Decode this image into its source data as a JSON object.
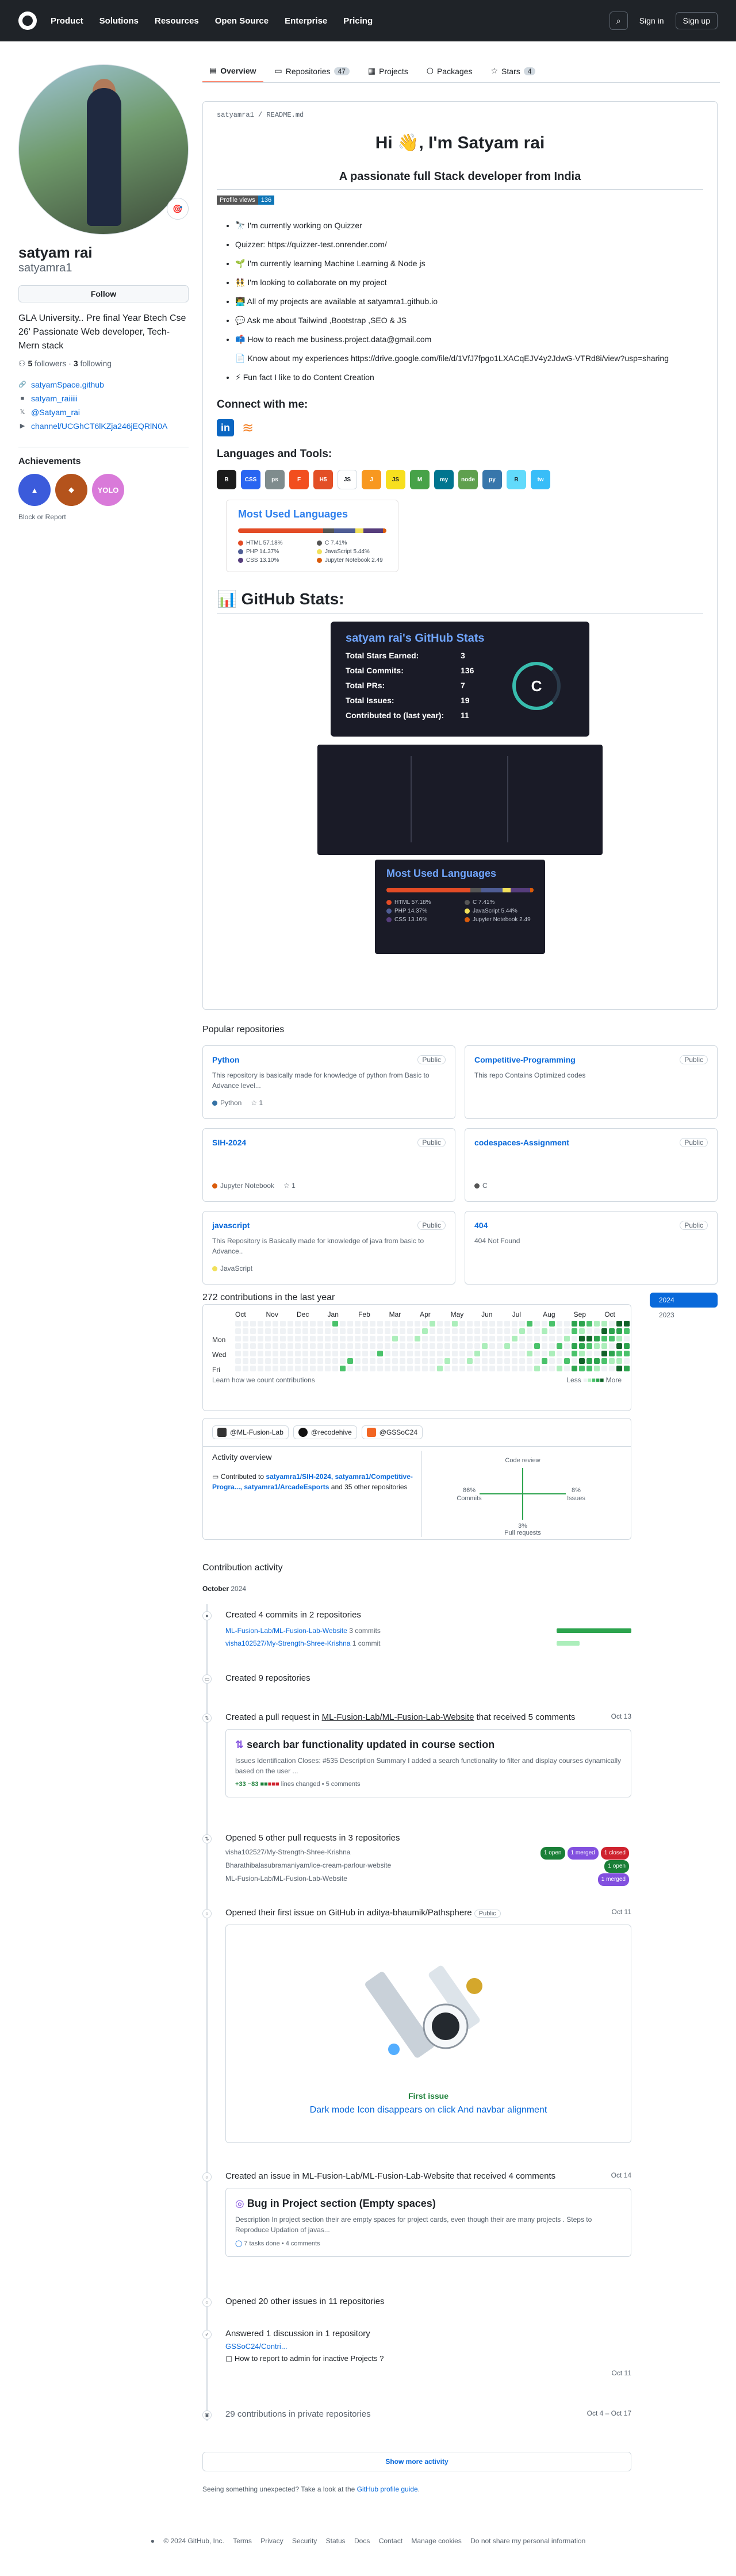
{
  "header": {
    "nav": [
      "Product",
      "Solutions",
      "Resources",
      "Open Source",
      "Enterprise",
      "Pricing"
    ],
    "sign_in": "Sign in",
    "sign_up": "Sign up"
  },
  "tabs": [
    {
      "label": "Overview",
      "count": ""
    },
    {
      "label": "Repositories",
      "count": "47"
    },
    {
      "label": "Projects",
      "count": ""
    },
    {
      "label": "Packages",
      "count": ""
    },
    {
      "label": "Stars",
      "count": "4"
    }
  ],
  "profile": {
    "name": "satyam rai",
    "login": "satyamra1",
    "follow": "Follow",
    "bio": "GLA University.. Pre final Year Btech Cse 26' Passionate Web developer, Tech-Mern stack",
    "followers": "5",
    "followers_label": "followers",
    "following": "3",
    "following_label": "following",
    "links": [
      "satyamSpace.github",
      "satyam_raiiiii",
      "@Satyam_rai",
      "channel/UCGhCT6lKZja246jEQRlN0A"
    ],
    "achievements_title": "Achievements",
    "block": "Block or Report"
  },
  "readme": {
    "path": "satyamra1 / README.md",
    "title": "Hi 👋, I'm Satyam rai",
    "subtitle": "A passionate full Stack developer from India",
    "profile_views_label": "Profile views",
    "profile_views": "136",
    "bullets": [
      "🔭 I'm currently working on Quizzer",
      "Quizzer: https://quizzer-test.onrender.com/",
      "🌱 I'm currently learning Machine Learning & Node js",
      "👯 I'm looking to collaborate on my project",
      "👨‍💻 All of my projects are available at satyamra1.github.io",
      "💬 Ask me about Tailwind ,Bootstrap ,SEO & JS",
      "📫 How to reach me business.project.data@gmail.com",
      "📄 Know about my experiences https://drive.google.com/file/d/1VfJ7fpgo1LXACqEJV4y2JdwG-VTRd8i/view?usp=sharing",
      "⚡ Fun fact I like to do Content Creation"
    ],
    "connect": "Connect with me:",
    "tools_title": "Languages and Tools:",
    "tools": [
      "B",
      "CSS",
      "ps",
      "F",
      "H5",
      "JS",
      "J",
      "JS",
      "M",
      "my",
      "node",
      "py",
      "R",
      "tw"
    ],
    "tool_colors": [
      "#1b1b1b",
      "#2965f1",
      "#7f8c8d",
      "#f24e1e",
      "#e34f26",
      "#ffffff",
      "#f89820",
      "#f7df1e",
      "#47a248",
      "#00758f",
      "#5fa04e",
      "#3776ab",
      "#61dafb",
      "#38bdf8"
    ],
    "most_used": "Most Used Languages",
    "languages": [
      {
        "name": "HTML",
        "pct": "57.18%",
        "color": "#e34c26",
        "v": 57.18
      },
      {
        "name": "C",
        "pct": "7.41%",
        "color": "#555555",
        "v": 7.41
      },
      {
        "name": "PHP",
        "pct": "14.37%",
        "color": "#4f5d95",
        "v": 14.37
      },
      {
        "name": "JavaScript",
        "pct": "5.44%",
        "color": "#f1e05a",
        "v": 5.44
      },
      {
        "name": "CSS",
        "pct": "13.10%",
        "color": "#563d7c",
        "v": 13.1
      },
      {
        "name": "Jupyter Notebook",
        "pct": "2.49",
        "color": "#da5b0b",
        "v": 2.49
      }
    ],
    "stats_heading": "📊 GitHub Stats:",
    "stats_title": "satyam rai's GitHub Stats",
    "stats": [
      {
        "label": "Total Stars Earned:",
        "value": "3"
      },
      {
        "label": "Total Commits:",
        "value": "136"
      },
      {
        "label": "Total PRs:",
        "value": "7"
      },
      {
        "label": "Total Issues:",
        "value": "19"
      },
      {
        "label": "Contributed to (last year):",
        "value": "11"
      }
    ],
    "grade": "C"
  },
  "popular": {
    "title": "Popular repositories",
    "repos": [
      {
        "name": "Python",
        "vis": "Public",
        "desc": "This repository is basically made for knowledge of python from Basic to Advance level...",
        "lang": "Python",
        "color": "#3572a5",
        "stars": "1"
      },
      {
        "name": "Competitive-Programming",
        "vis": "Public",
        "desc": "This repo Contains Optimized codes",
        "lang": "",
        "color": "",
        "stars": ""
      },
      {
        "name": "SIH-2024",
        "vis": "Public",
        "desc": "",
        "lang": "Jupyter Notebook",
        "color": "#da5b0b",
        "stars": "1"
      },
      {
        "name": "codespaces-Assignment",
        "vis": "Public",
        "desc": "",
        "lang": "C",
        "color": "#555555",
        "stars": ""
      },
      {
        "name": "javascript",
        "vis": "Public",
        "desc": "This Repository is Basically made for knowledge of java from basic to Advance..",
        "lang": "JavaScript",
        "color": "#f1e05a",
        "stars": ""
      },
      {
        "name": "404",
        "vis": "Public",
        "desc": "404 Not Found",
        "lang": "",
        "color": "",
        "stars": ""
      }
    ]
  },
  "contributions": {
    "title": "272 contributions in the last year",
    "months": [
      "Oct",
      "Nov",
      "Dec",
      "Jan",
      "Feb",
      "Mar",
      "Apr",
      "May",
      "Jun",
      "Jul",
      "Aug",
      "Sep",
      "Oct"
    ],
    "days": [
      "Mon",
      "Wed",
      "Fri"
    ],
    "learn": "Learn how we count contributions",
    "less": "Less",
    "more": "More",
    "years": [
      "2024",
      "2023"
    ]
  },
  "overview": {
    "orgs": [
      "@ML-Fusion-Lab",
      "@recodehive",
      "@GSSoC24"
    ],
    "org_colors": [
      "#333333",
      "#111111",
      "#f26522"
    ],
    "title": "Activity overview",
    "contributed_prefix": "Contributed to",
    "contributed_repos": "satyamra1/SIH-2024, satyamra1/Competitive-Progra..., satyamra1/ArcadeEsports",
    "contributed_more": "and 35 other repositories",
    "axes": {
      "top": "Code review",
      "left_pct": "86%",
      "left": "Commits",
      "right_pct": "8%",
      "right": "Issues",
      "bottom_pct": "3%",
      "bottom": "Pull requests"
    }
  },
  "activity": {
    "title": "Contribution activity",
    "month": "October",
    "year": "2024",
    "commits_title": "Created 4 commits in 2 repositories",
    "commit_repos": [
      {
        "name": "ML-Fusion-Lab/ML-Fusion-Lab-Website",
        "count": "3 commits",
        "v": 0.9
      },
      {
        "name": "visha102527/My-Strength-Shree-Krishna",
        "count": "1 commit",
        "v": 0.3
      }
    ],
    "repos_title": "Created 9 repositories",
    "pr_title_prefix": "Created a pull request in",
    "pr_repo": "ML-Fusion-Lab/ML-Fusion-Lab-Website",
    "pr_title_suffix": "that received 5 comments",
    "pr_date": "Oct 13",
    "pr_name": "search bar functionality updated in course section",
    "pr_desc": "Issues Identification Closes: #535 Description Summary I added a search functionality to filter and display courses dynamically based on the user ...",
    "pr_stats": "+33 −83",
    "pr_lines": "lines changed",
    "pr_comments": "• 5 comments",
    "open_prs_title": "Opened 5 other pull requests in 3 repositories",
    "open_prs": [
      {
        "name": "visha102527/My-Strength-Shree-Krishna",
        "badges": [
          "1 open",
          "1 merged",
          "1 closed"
        ]
      },
      {
        "name": "Bharathibalasubramaniyam/ice-cream-parlour-website",
        "badges": [
          "1 open"
        ]
      },
      {
        "name": "ML-Fusion-Lab/ML-Fusion-Lab-Website",
        "badges": [
          "1 merged"
        ]
      }
    ],
    "first_issue_prefix": "Opened their first issue on GitHub in",
    "first_issue_repo": "aditya-bhaumik/Pathsphere",
    "first_issue_vis": "Public",
    "first_issue_date": "Oct 11",
    "first_issue_label": "First issue",
    "first_issue_title": "Dark mode Icon disappears on click And navbar alignment",
    "issue_title": "Created an issue in ML-Fusion-Lab/ML-Fusion-Lab-Website that received 4 comments",
    "issue_date": "Oct 14",
    "issue_name": "Bug in Project section (Empty spaces)",
    "issue_desc": "Description In project section their are empty spaces for project cards, even though their are many projects . Steps to Reproduce Updation of javas...",
    "issue_meta": "7 tasks done • 4 comments",
    "other_issues": "Opened 20 other issues in 11 repositories",
    "discussion": "Answered 1 discussion in 1 repository",
    "discussion_repo": "GSSoC24/Contri...",
    "discussion_q": "How to report to admin for inactive Projects ?",
    "discussion_date": "Oct 11",
    "private": "29 contributions in private repositories",
    "private_date": "Oct 4 – Oct 17",
    "show_more": "Show more activity",
    "feedback_prefix": "Seeing something unexpected? Take a look at the",
    "feedback_link": "GitHub profile guide",
    "feedback_suffix": "."
  },
  "footer": [
    "© 2024 GitHub, Inc.",
    "Terms",
    "Privacy",
    "Security",
    "Status",
    "Docs",
    "Contact",
    "Manage cookies",
    "Do not share my personal information"
  ]
}
